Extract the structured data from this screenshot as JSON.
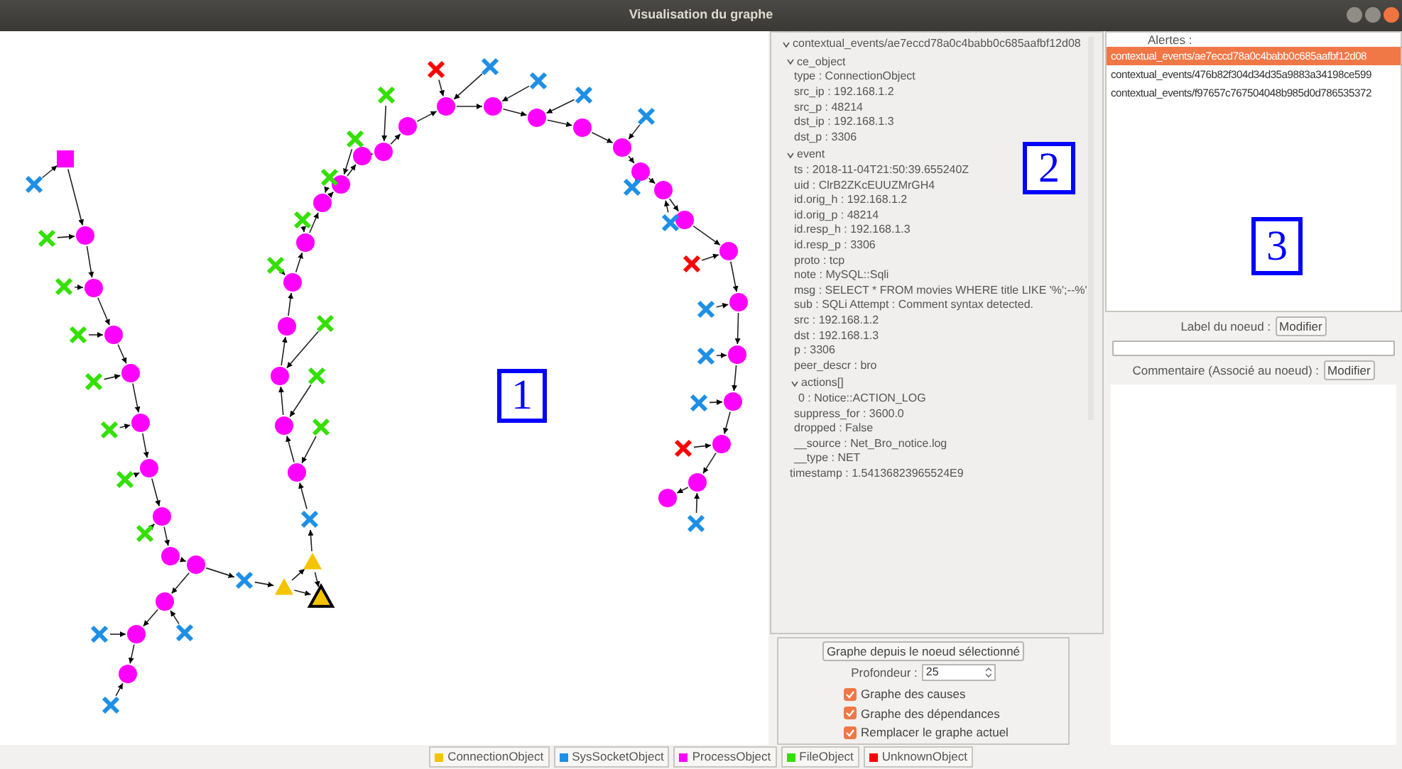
{
  "window": {
    "title": "Visualisation du graphe"
  },
  "graph": {
    "nodes": [
      {
        "kind": "process",
        "start": true,
        "selected": false
      },
      {
        "kind": "process",
        "start": false,
        "selected": false
      },
      {
        "kind": "process",
        "start": false,
        "selected": false
      },
      {
        "kind": "process",
        "start": false,
        "selected": false
      },
      {
        "kind": "process",
        "start": false,
        "selected": false
      },
      {
        "kind": "process",
        "start": false,
        "selected": false
      },
      {
        "kind": "process",
        "start": false,
        "selected": false
      },
      {
        "kind": "process",
        "start": false,
        "selected": false
      },
      {
        "kind": "process",
        "start": false,
        "selected": false
      },
      {
        "kind": "process",
        "start": false,
        "selected": false
      },
      {
        "kind": "process",
        "start": false,
        "selected": false
      },
      {
        "kind": "process",
        "start": false,
        "selected": false
      },
      {
        "kind": "process",
        "start": false,
        "selected": false
      },
      {
        "kind": "socket",
        "start": false,
        "selected": false
      },
      {
        "kind": "file",
        "start": false,
        "selected": false
      },
      {
        "kind": "file",
        "start": false,
        "selected": false
      },
      {
        "kind": "file",
        "start": false,
        "selected": false
      },
      {
        "kind": "file",
        "start": false,
        "selected": false
      },
      {
        "kind": "file",
        "start": false,
        "selected": false
      },
      {
        "kind": "file",
        "start": false,
        "selected": false
      },
      {
        "kind": "file",
        "start": false,
        "selected": false
      },
      {
        "kind": "socket",
        "start": false,
        "selected": false
      },
      {
        "kind": "socket",
        "start": false,
        "selected": false
      },
      {
        "kind": "socket",
        "start": false,
        "selected": false
      },
      {
        "kind": "socket",
        "start": false,
        "selected": false
      },
      {
        "kind": "connection",
        "start": false,
        "selected": false
      },
      {
        "kind": "connection",
        "start": false,
        "selected": false
      },
      {
        "kind": "connection",
        "start": false,
        "selected": true
      },
      {
        "kind": "socket",
        "start": false,
        "selected": false
      },
      {
        "kind": "process",
        "start": false,
        "selected": false
      },
      {
        "kind": "process",
        "start": false,
        "selected": false
      },
      {
        "kind": "process",
        "start": false,
        "selected": false
      },
      {
        "kind": "process",
        "start": false,
        "selected": false
      },
      {
        "kind": "process",
        "start": false,
        "selected": false
      },
      {
        "kind": "process",
        "start": false,
        "selected": false
      },
      {
        "kind": "process",
        "start": false,
        "selected": false
      },
      {
        "kind": "process",
        "start": false,
        "selected": false
      },
      {
        "kind": "process",
        "start": false,
        "selected": false
      },
      {
        "kind": "process",
        "start": false,
        "selected": false
      },
      {
        "kind": "process",
        "start": false,
        "selected": false
      },
      {
        "kind": "process",
        "start": false,
        "selected": false
      },
      {
        "kind": "process",
        "start": false,
        "selected": false
      },
      {
        "kind": "process",
        "start": false,
        "selected": false
      },
      {
        "kind": "process",
        "start": false,
        "selected": false
      },
      {
        "kind": "process",
        "start": false,
        "selected": false
      },
      {
        "kind": "process",
        "start": false,
        "selected": false
      },
      {
        "kind": "process",
        "start": false,
        "selected": false
      },
      {
        "kind": "process",
        "start": false,
        "selected": false
      },
      {
        "kind": "process",
        "start": false,
        "selected": false
      },
      {
        "kind": "process",
        "start": false,
        "selected": false
      },
      {
        "kind": "process",
        "start": false,
        "selected": false
      },
      {
        "kind": "process",
        "start": false,
        "selected": false
      },
      {
        "kind": "process",
        "start": false,
        "selected": false
      },
      {
        "kind": "process",
        "start": false,
        "selected": false
      },
      {
        "kind": "process",
        "start": false,
        "selected": false
      },
      {
        "kind": "file",
        "start": false,
        "selected": false
      },
      {
        "kind": "file",
        "start": false,
        "selected": false
      },
      {
        "kind": "file",
        "start": false,
        "selected": false
      },
      {
        "kind": "file",
        "start": false,
        "selected": false
      },
      {
        "kind": "file",
        "start": false,
        "selected": false
      },
      {
        "kind": "file",
        "start": false,
        "selected": false
      },
      {
        "kind": "file",
        "start": false,
        "selected": false
      },
      {
        "kind": "file",
        "start": false,
        "selected": false
      },
      {
        "kind": "unknown",
        "start": false,
        "selected": false
      },
      {
        "kind": "socket",
        "start": false,
        "selected": false
      },
      {
        "kind": "socket",
        "start": false,
        "selected": false
      },
      {
        "kind": "socket",
        "start": false,
        "selected": false
      },
      {
        "kind": "socket",
        "start": false,
        "selected": false
      },
      {
        "kind": "socket",
        "start": false,
        "selected": false
      },
      {
        "kind": "socket",
        "start": false,
        "selected": false
      },
      {
        "kind": "unknown",
        "start": false,
        "selected": false
      },
      {
        "kind": "socket",
        "start": false,
        "selected": false
      },
      {
        "kind": "socket",
        "start": false,
        "selected": false
      },
      {
        "kind": "socket",
        "start": false,
        "selected": false
      },
      {
        "kind": "unknown",
        "start": false,
        "selected": false
      },
      {
        "kind": "socket",
        "start": false,
        "selected": false
      }
    ]
  },
  "annotations": [
    {
      "label": "1"
    },
    {
      "label": "2"
    },
    {
      "label": "3"
    }
  ],
  "tree": {
    "label": "contextual_events/ae7eccd78a0c4babb0c685aafbf12d08",
    "expanded": true,
    "children": [
      {
        "label": "ce_object",
        "expanded": true,
        "children": [
          {
            "label": "type : ConnectionObject"
          },
          {
            "label": "src_ip : 192.168.1.2"
          },
          {
            "label": "src_p : 48214"
          },
          {
            "label": "dst_ip : 192.168.1.3"
          },
          {
            "label": "dst_p : 3306"
          }
        ]
      },
      {
        "label": "event",
        "expanded": true,
        "children": [
          {
            "label": "ts : 2018-11-04T21:50:39.655240Z"
          },
          {
            "label": "uid : ClrB2ZKcEUUZMrGH4"
          },
          {
            "label": "id.orig_h : 192.168.1.2"
          },
          {
            "label": "id.orig_p : 48214"
          },
          {
            "label": "id.resp_h : 192.168.1.3"
          },
          {
            "label": "id.resp_p : 3306"
          },
          {
            "label": "proto : tcp"
          },
          {
            "label": "note : MySQL::Sqli"
          },
          {
            "label": "msg : SELECT * FROM movies WHERE title LIKE '%';--%'"
          },
          {
            "label": "sub : SQLi Attempt : Comment syntax detected."
          },
          {
            "label": "src : 192.168.1.2"
          },
          {
            "label": "dst : 192.168.1.3"
          },
          {
            "label": "p : 3306"
          },
          {
            "label": "peer_descr : bro"
          },
          {
            "label": "actions[]",
            "expanded": true,
            "children": [
              {
                "label": "0 : Notice::ACTION_LOG"
              }
            ]
          },
          {
            "label": "suppress_for : 3600.0"
          },
          {
            "label": "dropped : False"
          },
          {
            "label": "__source : Net_Bro_notice.log"
          },
          {
            "label": "__type : NET"
          }
        ]
      },
      {
        "label": "timestamp : 1.54136823965524E9"
      }
    ]
  },
  "controls": {
    "graph_button": "Graphe depuis le noeud sélectionné",
    "depth_label": "Profondeur :",
    "depth_value": "25",
    "options": [
      {
        "label": "Graphe des causes",
        "checked": true
      },
      {
        "label": "Graphe des dépendances",
        "checked": true
      },
      {
        "label": "Remplacer le graphe actuel",
        "checked": true
      }
    ]
  },
  "alerts": {
    "title": "Alertes :",
    "items": [
      {
        "label": "contextual_events/ae7eccd78a0c4babb0c685aafbf12d08",
        "selected": true
      },
      {
        "label": "contextual_events/476b82f304d34d35a9883a34198ce599",
        "selected": false
      },
      {
        "label": "contextual_events/f97657c767504048b985d0d786535372",
        "selected": false
      }
    ]
  },
  "node_label": {
    "label": "Label du noeud :",
    "button": "Modifier"
  },
  "comment": {
    "label": "Commentaire (Associé au noeud) :",
    "button": "Modifier"
  },
  "legend": [
    {
      "kind": "connection",
      "label": "ConnectionObject",
      "color": "#f5c400"
    },
    {
      "kind": "socket",
      "label": "SysSocketObject",
      "color": "#1e8fe6"
    },
    {
      "kind": "process",
      "label": "ProcessObject",
      "color": "#ff00ff"
    },
    {
      "kind": "file",
      "label": "FileObject",
      "color": "#33e000"
    },
    {
      "kind": "unknown",
      "label": "UnknownObject",
      "color": "#ff0000"
    }
  ]
}
